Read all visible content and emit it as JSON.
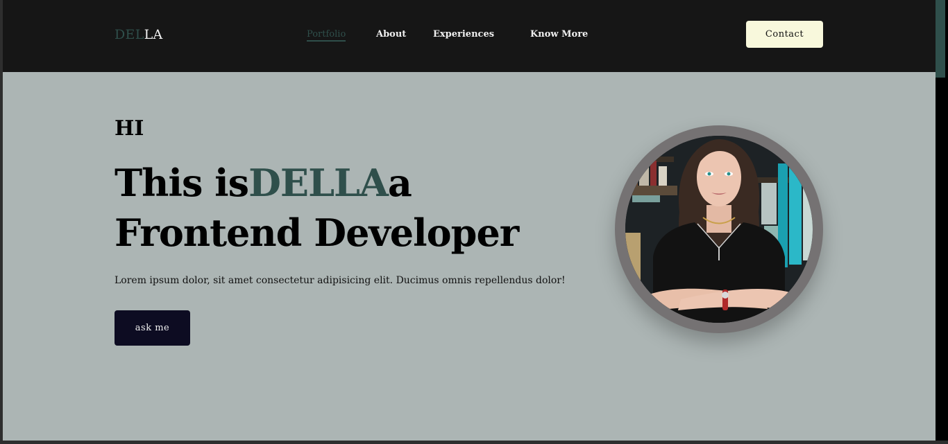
{
  "header": {
    "logo": {
      "part1": "DEL",
      "part2": "LA"
    },
    "nav": {
      "portfolio": "Portfolio",
      "about": "About",
      "experiences": "Experiences",
      "know_more": "Know More"
    },
    "contact_label": "Contact"
  },
  "hero": {
    "greeting": "HI",
    "headline": {
      "prefix": "This is",
      "name": "DELLA",
      "suffix": "a Frontend Developer"
    },
    "lead": "Lorem ipsum dolor, sit amet consectetur adipisicing elit. Ducimus omnis repellendus dolor!",
    "cta_label": "ask me",
    "image": "portrait-photo"
  },
  "colors": {
    "accent": "#2f4f4b",
    "header_bg": "#161616",
    "page_bg": "#acb5b4",
    "contact_bg": "#f8f8dc",
    "cta_bg": "#0d0c22",
    "ring": "#757273"
  }
}
